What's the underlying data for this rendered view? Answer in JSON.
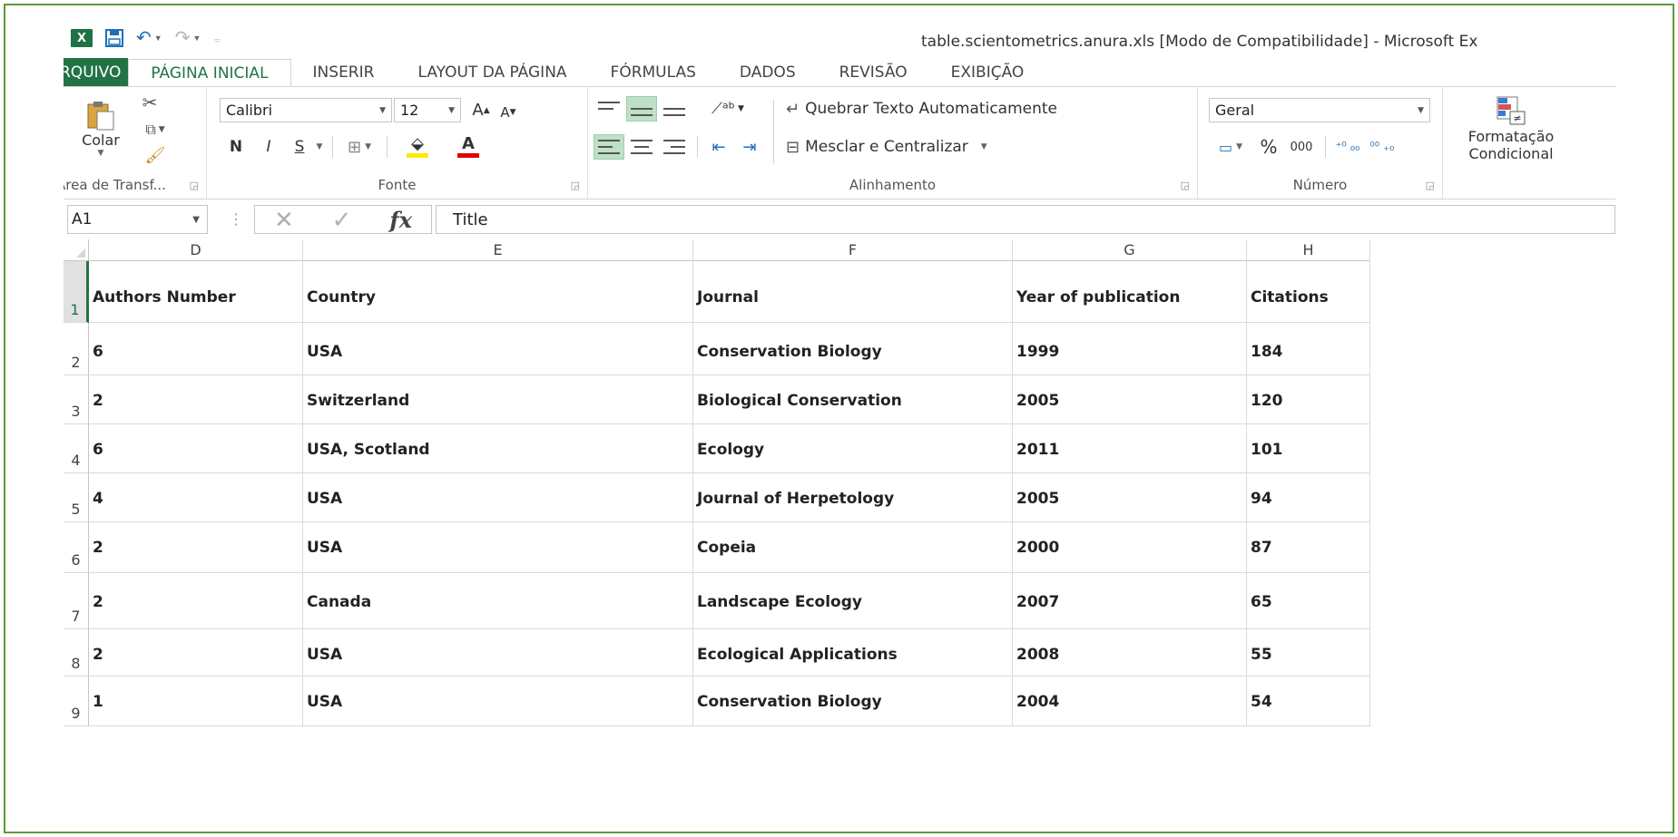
{
  "app": {
    "title": "table.scientometrics.anura.xls  [Modo de Compatibilidade] - Microsoft Ex",
    "logo": "X"
  },
  "qat": {
    "save_icon": "save-icon",
    "undo_icon": "undo-icon",
    "redo_icon": "redo-icon",
    "customize_icon": "customize-icon"
  },
  "tabs": [
    "RQUIVO",
    "PÁGINA INICIAL",
    "INSERIR",
    "LAYOUT DA PÁGINA",
    "FÓRMULAS",
    "DADOS",
    "REVISÃO",
    "EXIBIÇÃO"
  ],
  "ribbon": {
    "clipboard": {
      "label": "Área de Transf...",
      "paste_label": "Colar"
    },
    "font": {
      "label": "Fonte",
      "font_name": "Calibri",
      "font_size": "12",
      "bold": "N",
      "italic": "I",
      "underline": "S"
    },
    "alignment": {
      "label": "Alinhamento",
      "wrap_text": "Quebrar Texto Automaticamente",
      "merge_center": "Mesclar e Centralizar"
    },
    "number": {
      "label": "Número",
      "format": "Geral",
      "percent": "%",
      "thousands": "000"
    },
    "styles": {
      "conditional_line1": "Formatação",
      "conditional_line2": "Condicional"
    }
  },
  "formula_bar": {
    "name_box": "A1",
    "fx": "fx",
    "content": "Title"
  },
  "grid": {
    "columns": [
      "D",
      "E",
      "F",
      "G",
      "H"
    ],
    "rows": [
      {
        "num": "1",
        "cells": [
          "Authors Number",
          "Country",
          "Journal",
          "Year of publication",
          "Citations"
        ]
      },
      {
        "num": "2",
        "cells": [
          "6",
          "USA",
          "Conservation Biology",
          "1999",
          "184"
        ]
      },
      {
        "num": "3",
        "cells": [
          "2",
          "Switzerland",
          "Biological Conservation",
          "2005",
          "120"
        ]
      },
      {
        "num": "4",
        "cells": [
          "6",
          "USA, Scotland",
          "Ecology",
          "2011",
          "101"
        ]
      },
      {
        "num": "5",
        "cells": [
          "4",
          "USA",
          "Journal of Herpetology",
          "2005",
          "94"
        ]
      },
      {
        "num": "6",
        "cells": [
          "2",
          "USA",
          "Copeia",
          "2000",
          "87"
        ]
      },
      {
        "num": "7",
        "cells": [
          "2",
          "Canada",
          "Landscape Ecology",
          "2007",
          "65"
        ]
      },
      {
        "num": "8",
        "cells": [
          "2",
          "USA",
          "Ecological Applications",
          "2008",
          "55"
        ]
      },
      {
        "num": "9",
        "cells": [
          "1",
          "USA",
          "Conservation Biology",
          "2004",
          "54"
        ]
      }
    ]
  }
}
